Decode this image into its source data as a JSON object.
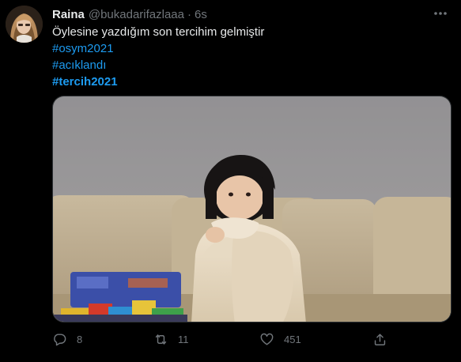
{
  "tweet": {
    "author_name": "Raina",
    "author_handle": "@bukadarifazlaaa",
    "separator": "·",
    "time": "6s",
    "text_line": "Öylesine yazdığım son tercihim gelmiştir",
    "hashtags": [
      "#osym2021",
      "#acıklandı",
      "#tercih2021"
    ]
  },
  "actions": {
    "reply_count": "8",
    "retweet_count": "11",
    "like_count": "451"
  },
  "colors": {
    "background": "#000000",
    "text": "#e7e9ea",
    "muted": "#71767b",
    "link": "#1d9bf0"
  },
  "icons": [
    "avatar",
    "more-icon",
    "reply-icon",
    "retweet-icon",
    "like-icon",
    "share-icon"
  ]
}
